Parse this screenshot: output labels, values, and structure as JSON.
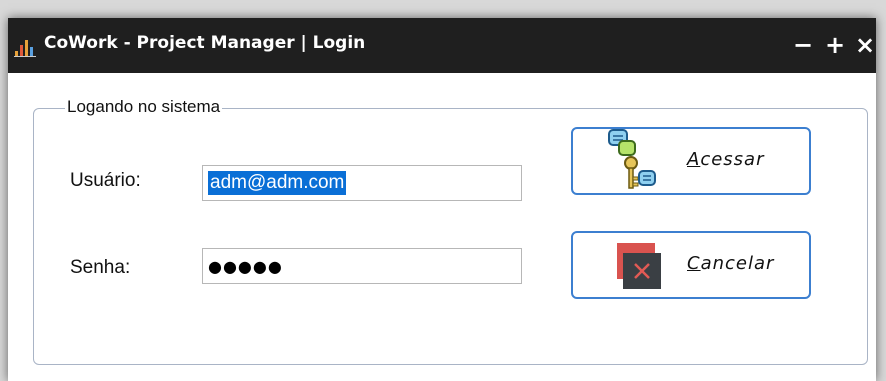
{
  "window": {
    "title": "CoWork - Project Manager | Login",
    "app_icon": "bar-chart-icon",
    "controls": {
      "minimize": "−",
      "maximize": "+",
      "close": "×"
    }
  },
  "form": {
    "group_label": "Logando no sistema",
    "username": {
      "label": "Usuário:",
      "value": "adm@adm.com"
    },
    "password": {
      "label": "Senha:",
      "masked_value": "●●●●●"
    }
  },
  "buttons": {
    "acessar": {
      "mnemonic": "A",
      "rest": "cessar",
      "icon": "keys-icon"
    },
    "cancelar": {
      "mnemonic": "C",
      "rest": "ancelar",
      "icon": "cancel-icon"
    }
  },
  "colors": {
    "titlebar": "#1f1f1f",
    "button_border": "#3c7fd0",
    "selection": "#0a6fd6",
    "cancel_red": "#d9534f"
  }
}
